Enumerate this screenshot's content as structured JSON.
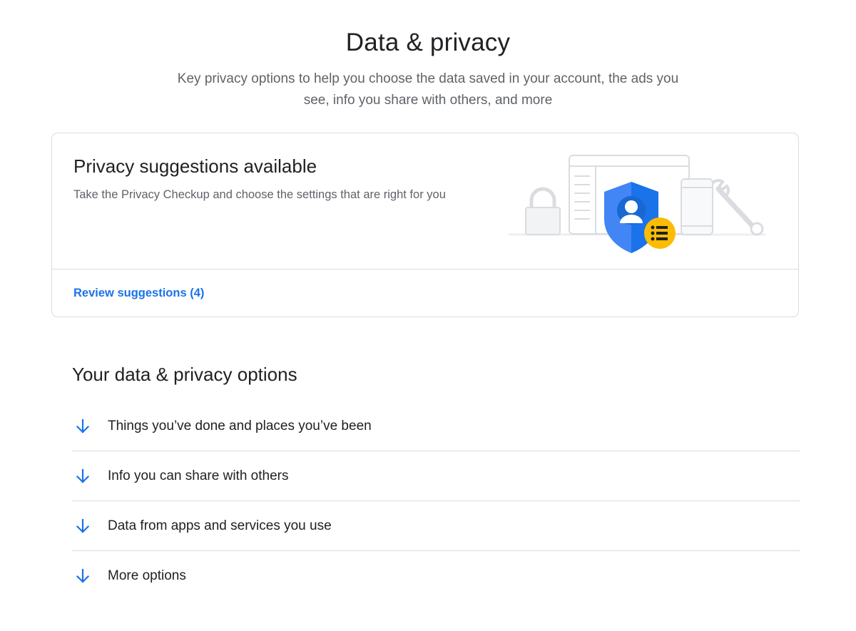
{
  "header": {
    "title": "Data & privacy",
    "subtitle_line1": "Key privacy options to help you choose the data saved in your account, the ads you",
    "subtitle_line2": "see, info you share with others, and more"
  },
  "suggestions_card": {
    "title": "Privacy suggestions available",
    "description": "Take the Privacy Checkup and choose the settings that are right for you",
    "link_label": "Review suggestions (4)",
    "illustration": "privacy-checkup-illustration"
  },
  "options_section": {
    "title": "Your data & privacy options",
    "items": [
      {
        "label": "Things you’ve done and places you’ve been",
        "icon": "arrow-down-icon"
      },
      {
        "label": "Info you can share with others",
        "icon": "arrow-down-icon"
      },
      {
        "label": "Data from apps and services you use",
        "icon": "arrow-down-icon"
      },
      {
        "label": "More options",
        "icon": "arrow-down-icon"
      }
    ]
  },
  "colors": {
    "accent": "#1a73e8",
    "text_primary": "#202124",
    "text_secondary": "#5f6368",
    "divider": "#dadce0",
    "shield_blue": "#4285f4",
    "badge_yellow": "#fbbc04"
  }
}
